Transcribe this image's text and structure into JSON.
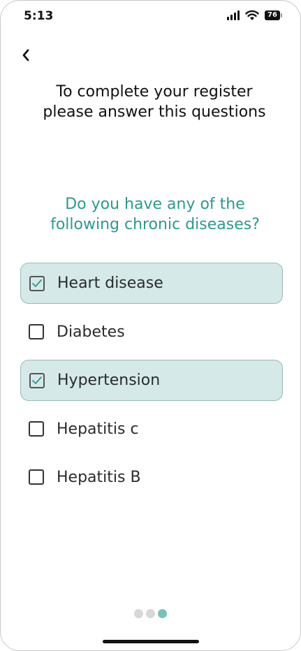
{
  "status_bar": {
    "time": "5:13",
    "battery": "76"
  },
  "heading": "To complete your register please answer this questions",
  "question": "Do you have any of the following chronic diseases?",
  "options": [
    {
      "label": "Heart disease",
      "checked": true
    },
    {
      "label": "Diabetes",
      "checked": false
    },
    {
      "label": "Hypertension",
      "checked": true
    },
    {
      "label": "Hepatitis c",
      "checked": false
    },
    {
      "label": "Hepatitis B",
      "checked": false
    }
  ],
  "pager": {
    "total": 3,
    "current": 3
  },
  "colors": {
    "accent": "#2a9a8f",
    "selected_bg": "#d5e9e9",
    "dot_active": "#77c0bb",
    "dot_inactive": "#d7d7d7"
  },
  "icons": {
    "back": "chevron-left-icon",
    "check": "check-icon"
  }
}
